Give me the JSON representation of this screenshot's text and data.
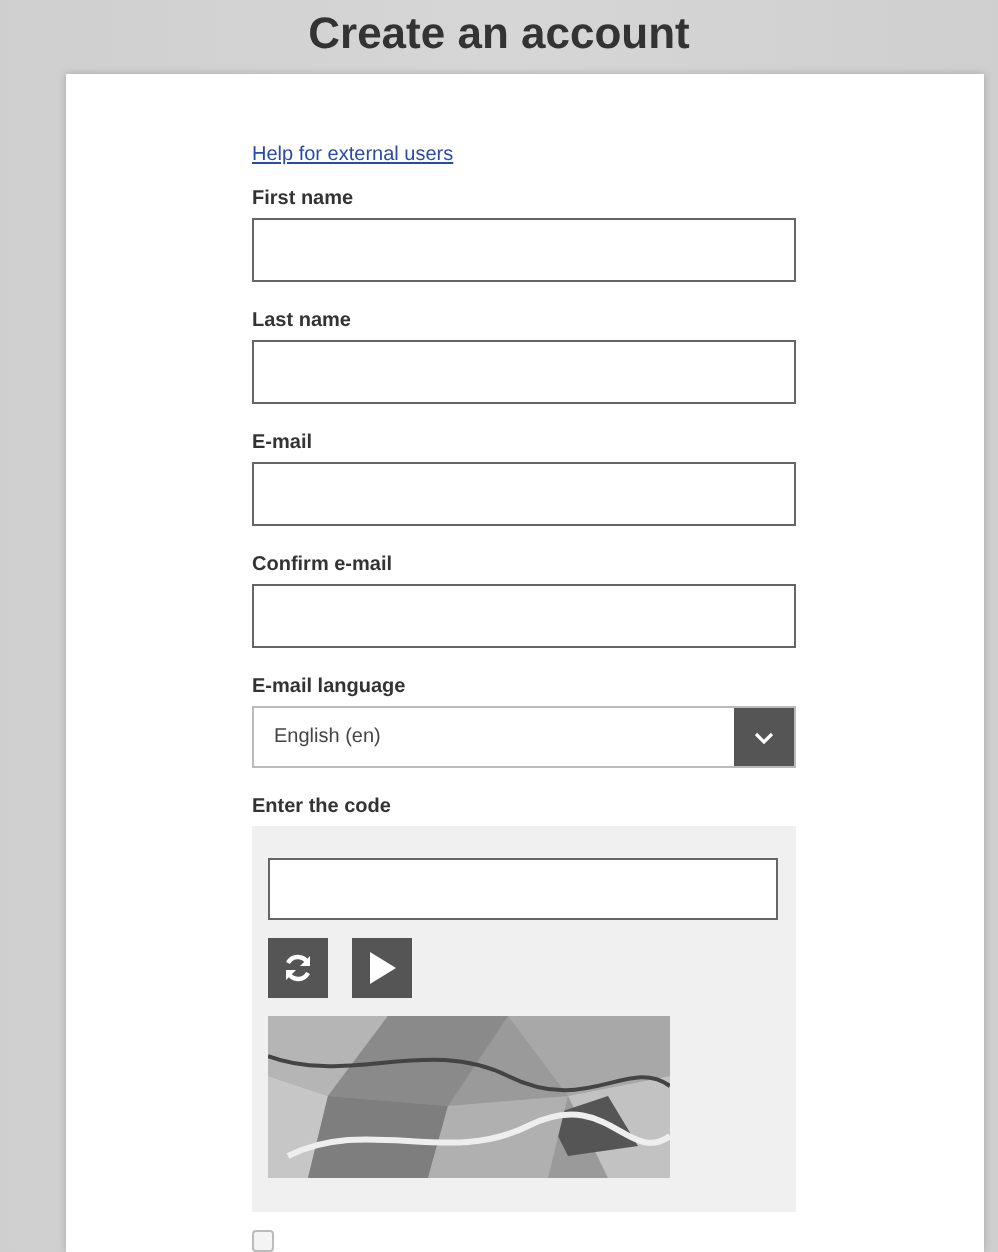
{
  "title": "Create an account",
  "help_link": "Help for external users",
  "fields": [
    {
      "label": "First name"
    },
    {
      "label": "Last name"
    },
    {
      "label": "E-mail"
    },
    {
      "label": "Confirm e-mail"
    }
  ],
  "language": {
    "label": "E-mail language",
    "value": "English (en)"
  },
  "captcha": {
    "label": "Enter the code"
  },
  "terms_checkbox": {
    "checked": false
  }
}
